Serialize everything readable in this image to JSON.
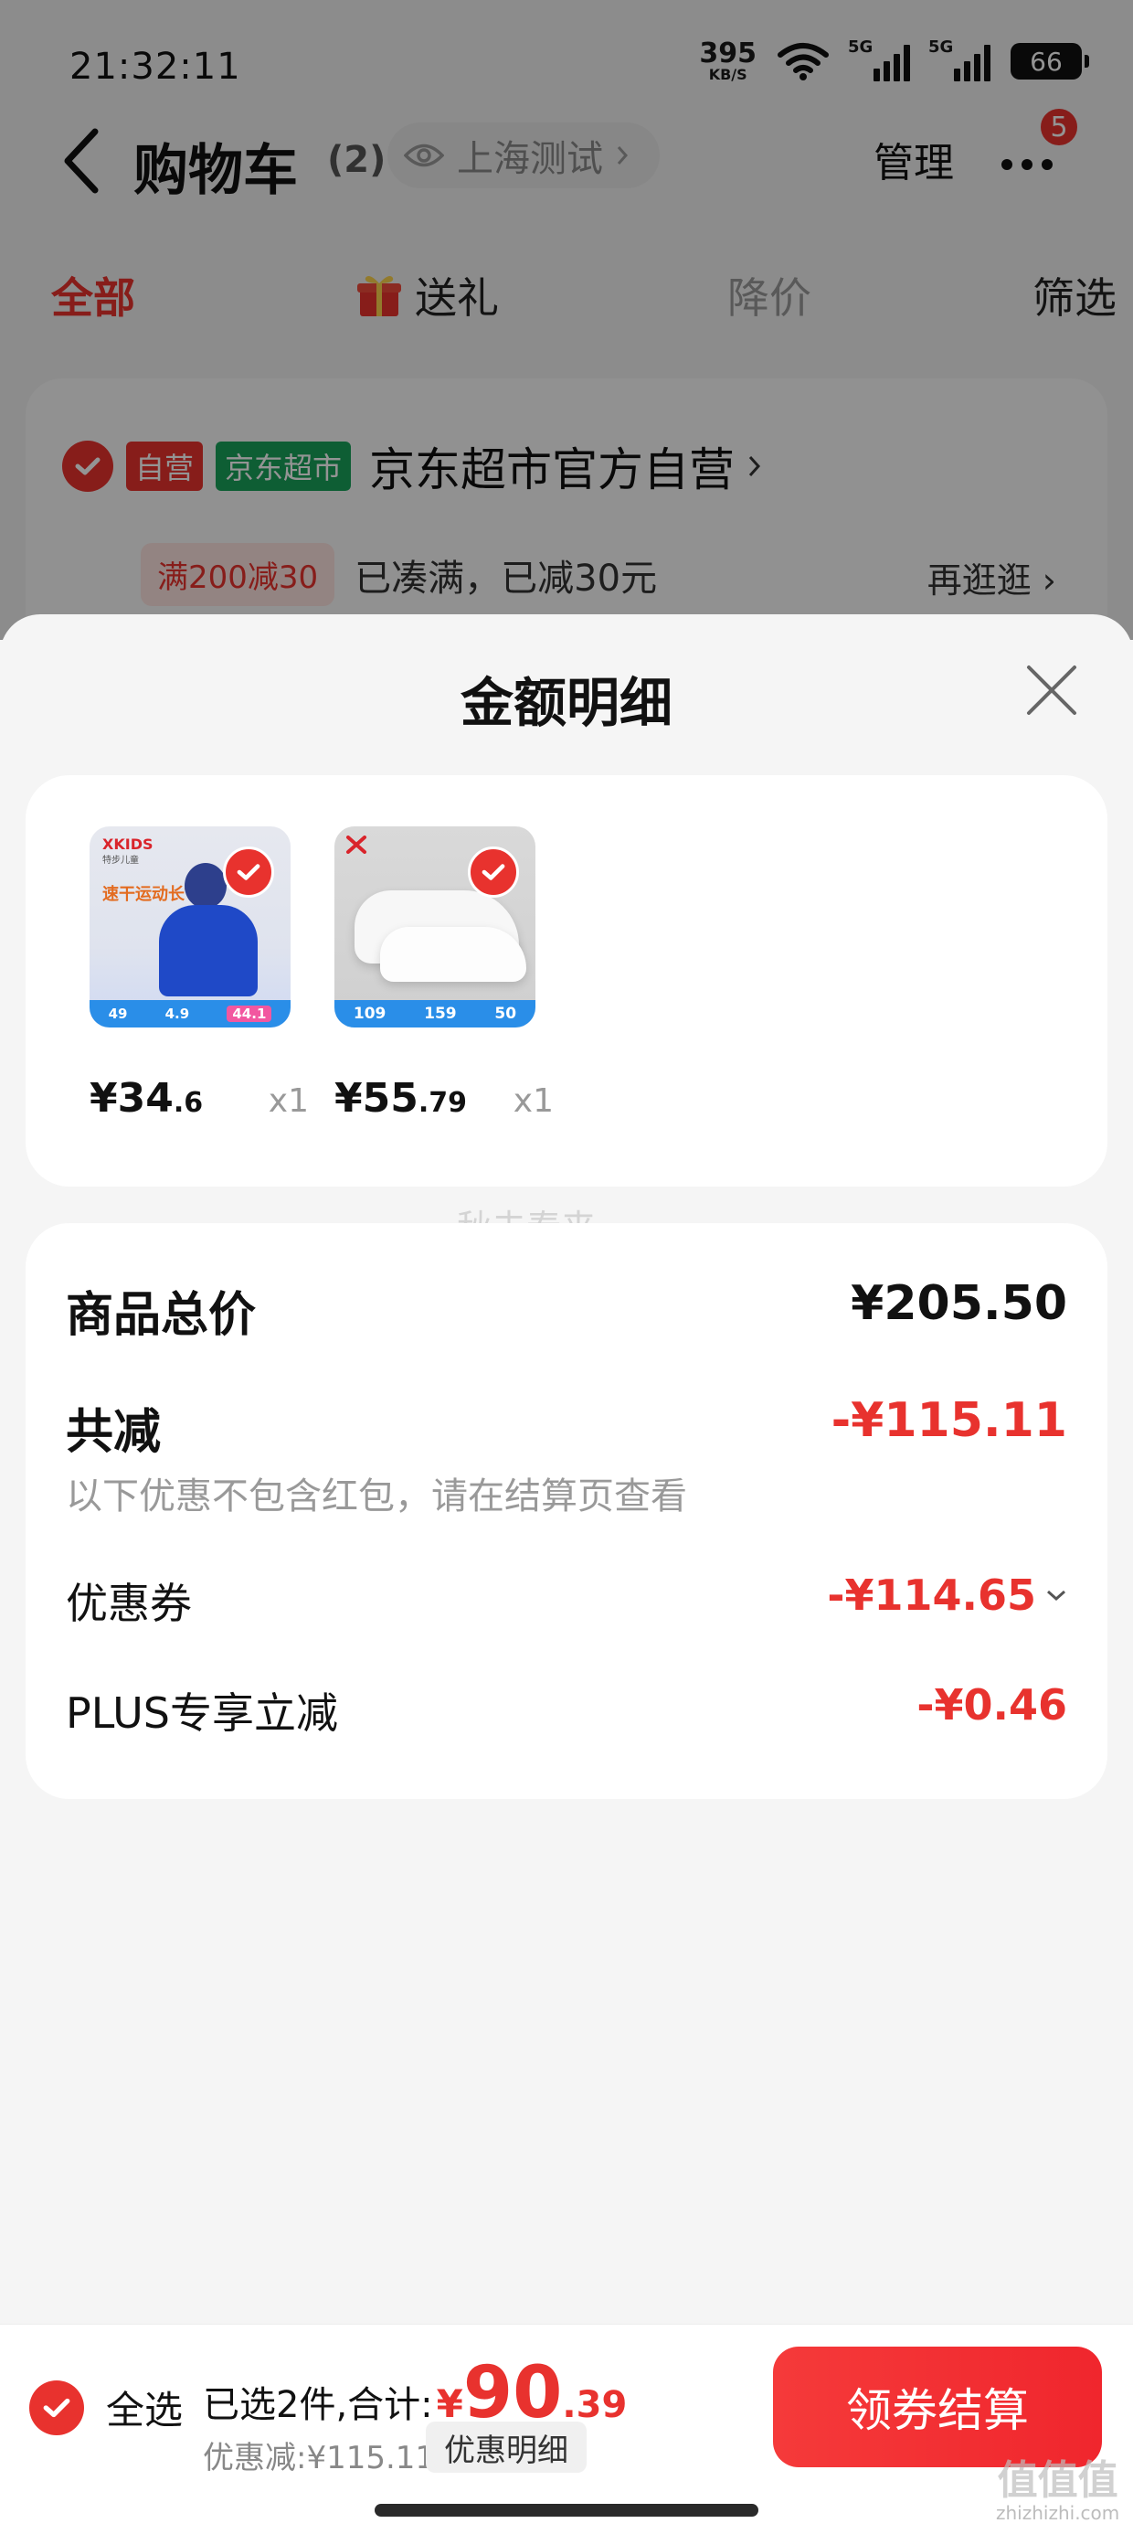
{
  "status_bar": {
    "time": "21:32:11",
    "net_speed": "395",
    "net_unit": "KB/S",
    "sig1_label": "5G",
    "sig2_label": "5G",
    "battery": "66"
  },
  "nav": {
    "title": "购物车",
    "count": "(2)",
    "location": "上海测试",
    "manage": "管理",
    "badge": "5"
  },
  "tabs": [
    {
      "label": "全部"
    },
    {
      "label": "送礼"
    },
    {
      "label": "降价"
    },
    {
      "label": "筛选"
    }
  ],
  "store": {
    "tag_self": "自营",
    "tag_market": "京东超市",
    "name": "京东超市官方自营",
    "promo_tag": "满200减30",
    "promo_text": "已凑满，已减30元",
    "more": "再逛逛"
  },
  "sheet": {
    "title": "金额明细",
    "goods": [
      {
        "price_int": "¥34",
        "price_dec": ".6",
        "qty": "x1",
        "thumb_brand": "XKIDS",
        "thumb_sub": "特步儿童",
        "thumb_text": "速干运动长T",
        "thumb_prices": [
          "49",
          "4.9",
          "44.1"
        ]
      },
      {
        "price_int": "¥55",
        "price_dec": ".79",
        "qty": "x1",
        "thumb_prices": [
          "109",
          "159",
          "50"
        ]
      }
    ],
    "watermark": "秋去春来",
    "summary": {
      "total_label": "商品总价",
      "total_value": "¥205.50",
      "discount_label": "共减",
      "discount_value": "-¥115.11",
      "note": "以下优惠不包含红包，请在结算页查看",
      "coupon_label": "优惠券",
      "coupon_value": "-¥114.65",
      "plus_label": "PLUS专享立减",
      "plus_value": "-¥0.46"
    }
  },
  "bottom": {
    "select_all": "全选",
    "selected_text": "已选2件,合计:",
    "currency": "¥",
    "total_int": "90",
    "total_dec": ".39",
    "discount_text": "优惠减:¥115.11",
    "detail_btn": "优惠明细",
    "checkout": "领券结算"
  },
  "corner_watermark": {
    "logo": "值值值",
    "url": "zhizhizhi.com"
  },
  "colors": {
    "accent_red": "#e8322e",
    "jd_green": "#19a35b",
    "sheet_bg": "#f5f5f5"
  }
}
